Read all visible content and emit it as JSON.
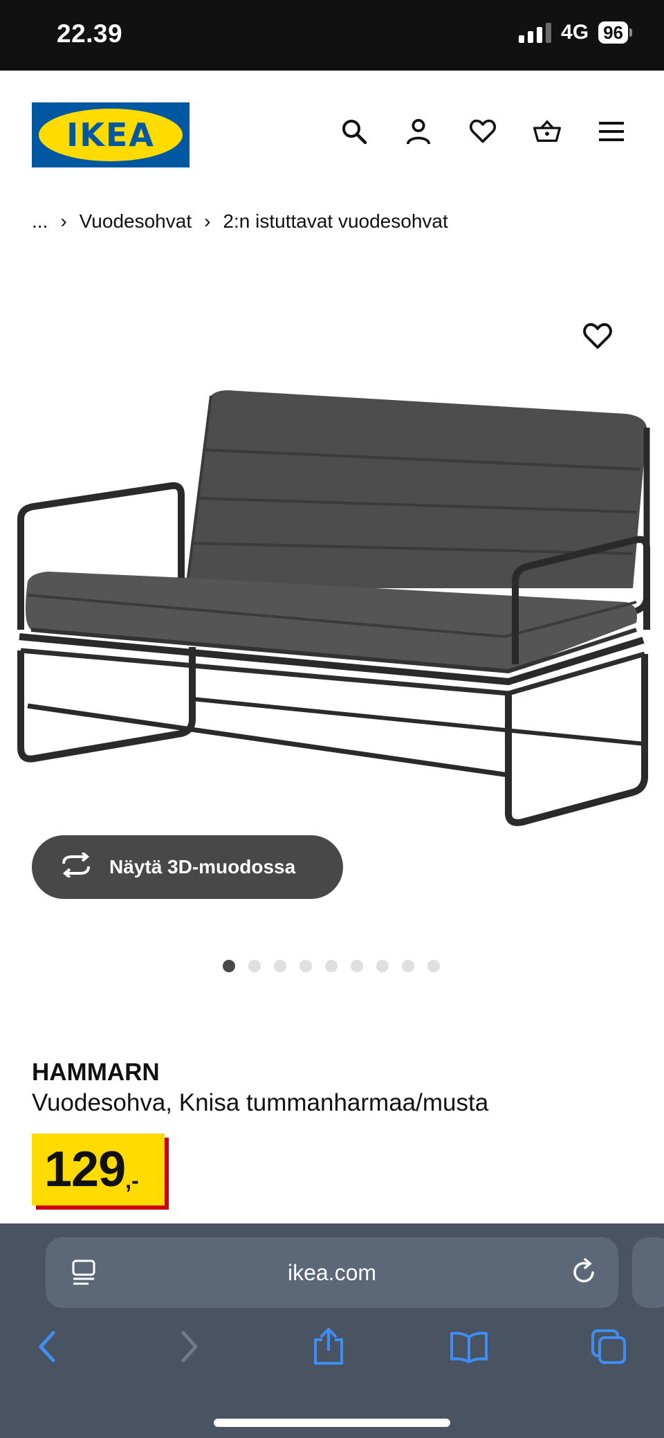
{
  "status_bar": {
    "time": "22.39",
    "network": "4G",
    "battery": "96"
  },
  "header": {
    "logo_text": "IKEA",
    "icons": [
      "search-icon",
      "user-icon",
      "heart-icon",
      "cart-icon",
      "menu-icon"
    ]
  },
  "breadcrumb": {
    "items": [
      "...",
      "Vuodesohvat",
      "2:n istuttavat vuodesohvat"
    ]
  },
  "product": {
    "view3d_label": "Näytä 3D-muodossa",
    "image_count": 9,
    "active_image": 1,
    "name": "HAMMARN",
    "description": "Vuodesohva, Knisa tummanharmaa/musta",
    "price_integer": "129",
    "price_decimal": ",-"
  },
  "browser": {
    "url": "ikea.com"
  },
  "colors": {
    "ikea_blue": "#0058a3",
    "ikea_yellow": "#ffdb00",
    "price_red": "#cc0008",
    "safari_bar": "#4a5361",
    "safari_blue": "#3f8ef5"
  }
}
